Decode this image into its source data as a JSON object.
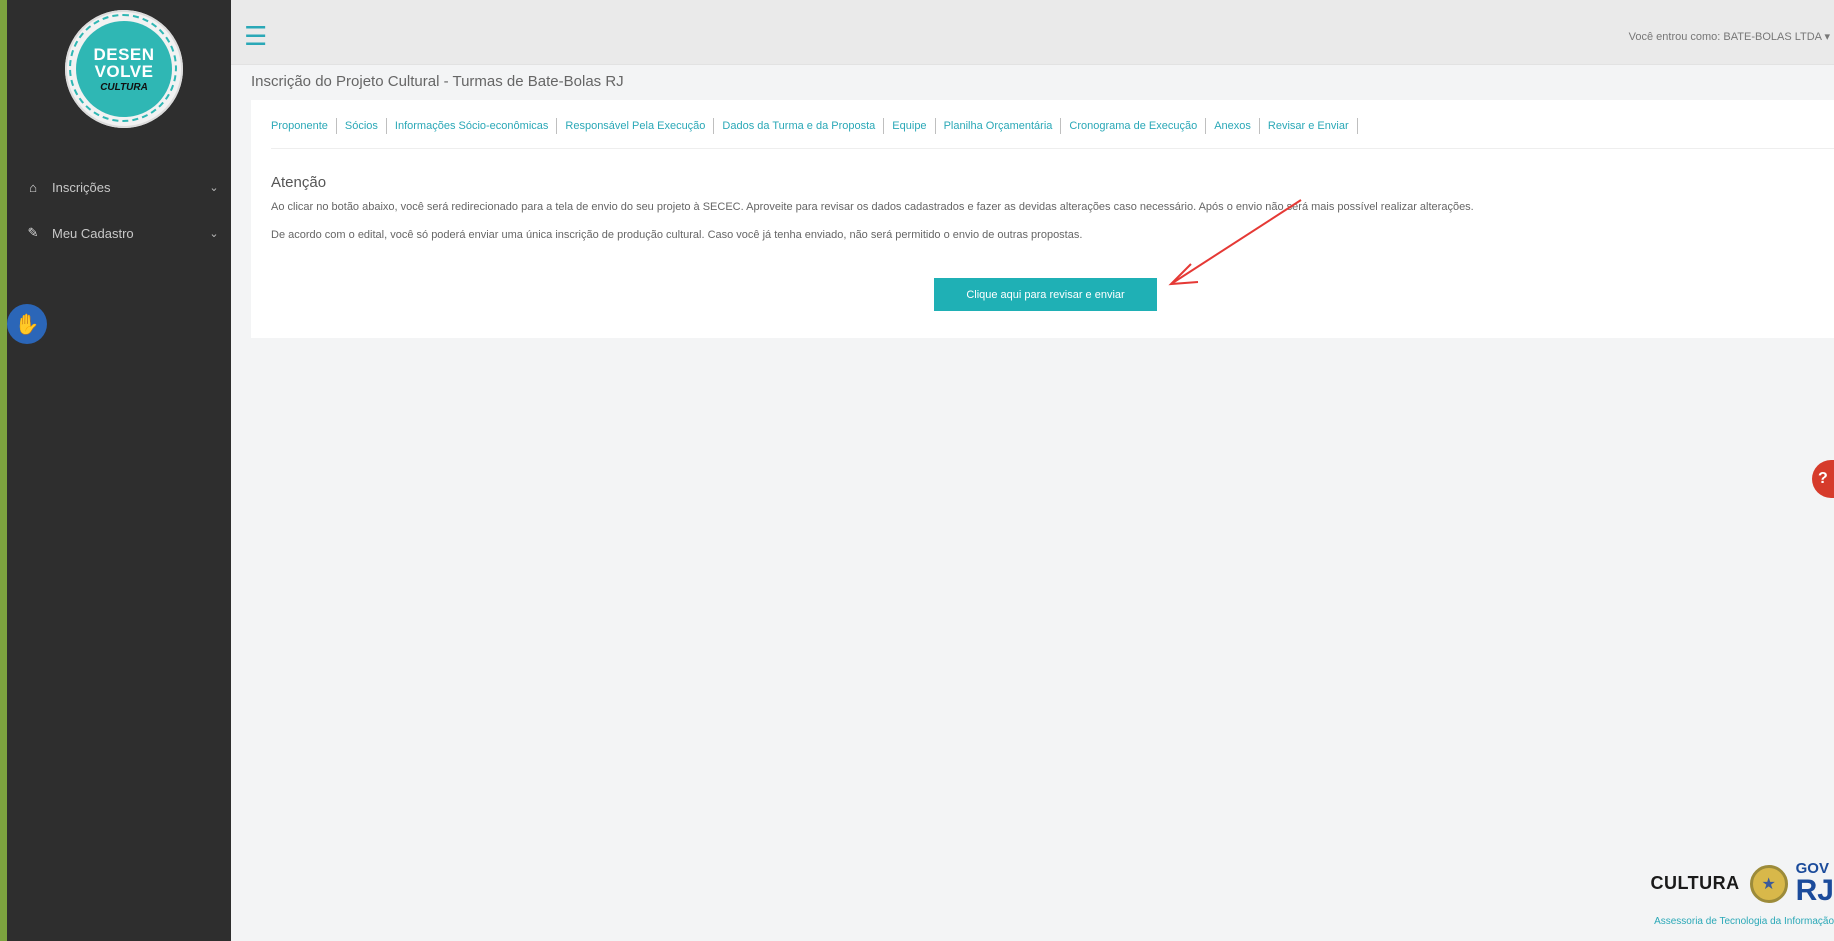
{
  "sidebar": {
    "logo": {
      "line1": "DESEN",
      "line2": "VOLVE",
      "line3": "CULTURA"
    },
    "items": [
      {
        "label": "Inscrições",
        "icon": "home-icon",
        "glyph": "🏠"
      },
      {
        "label": "Meu Cadastro",
        "icon": "edit-icon",
        "glyph": "✎"
      }
    ],
    "accessibility_icon": "accessibility-hand-icon"
  },
  "header": {
    "user_info": "Você entrou como: BATE-BOLAS LTDA ▾"
  },
  "page": {
    "title": "Inscrição do Projeto Cultural - Turmas de Bate-Bolas RJ"
  },
  "tabs": [
    "Proponente",
    "Sócios",
    "Informações Sócio-econômicas",
    "Responsável Pela Execução",
    "Dados da Turma e da Proposta",
    "Equipe",
    "Planilha Orçamentária",
    "Cronograma de Execução",
    "Anexos",
    "Revisar e Enviar"
  ],
  "attention": {
    "title": "Atenção",
    "p1": "Ao clicar no botão abaixo, você será redirecionado para a tela de envio do seu projeto à SECEC. Aproveite para revisar os dados cadastrados e fazer as devidas alterações caso necessário. Após o envio não será mais possível realizar alterações.",
    "p2": "De acordo com o edital, você só poderá enviar uma única inscrição de produção cultural. Caso você já tenha enviado, não será permitido o envio de outras propostas.",
    "button_label": "Clique aqui para revisar e enviar"
  },
  "footer": {
    "cultura_label": "CULTURA",
    "gov_top": "GOV",
    "gov_bottom": "RJ",
    "caption": "Assessoria de Tecnologia da Informação"
  },
  "colors": {
    "accent": "#2aa8b7",
    "button": "#1fb0b5",
    "sidebar": "#2e2e2e",
    "arrow": "#e53935"
  }
}
